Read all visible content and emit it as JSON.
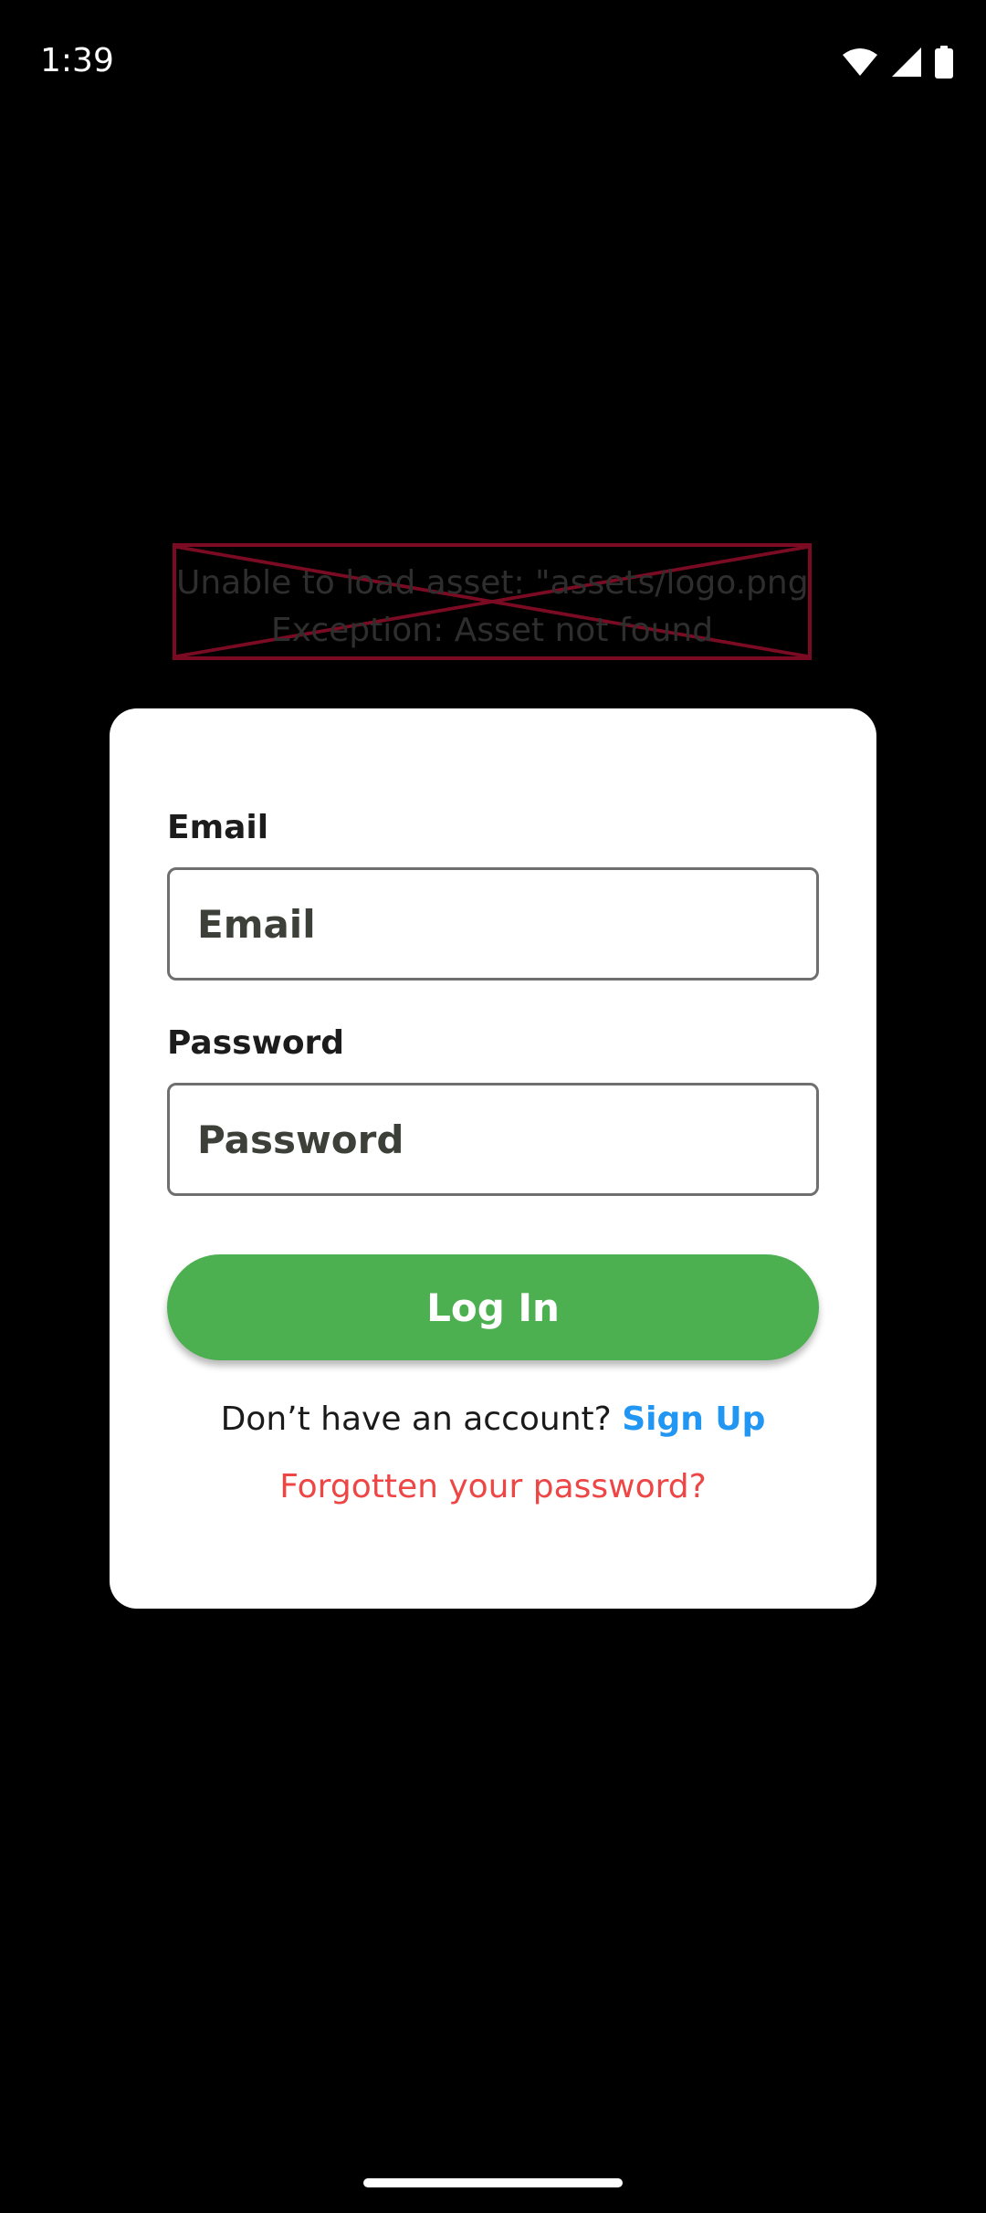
{
  "status_bar": {
    "time": "1:39",
    "icons": [
      "wifi-icon",
      "cellular-signal-icon",
      "battery-icon"
    ]
  },
  "asset_error": {
    "line1": "Unable to load asset: \"assets/logo.png\".",
    "line2": "Exception: Asset not found"
  },
  "form": {
    "email_label": "Email",
    "email_placeholder": "Email",
    "email_value": "",
    "password_label": "Password",
    "password_placeholder": "Password",
    "password_value": "",
    "login_label": "Log In",
    "signup_prompt": "Don’t have an account?",
    "signup_link": "Sign Up",
    "forgot_link": "Forgotten your password?"
  },
  "colors": {
    "background": "#000000",
    "card": "#ffffff",
    "primary_button": "#4caf50",
    "signup_link": "#2196f3",
    "forgot_link": "#ee4545",
    "error_border": "#7a0b22"
  }
}
